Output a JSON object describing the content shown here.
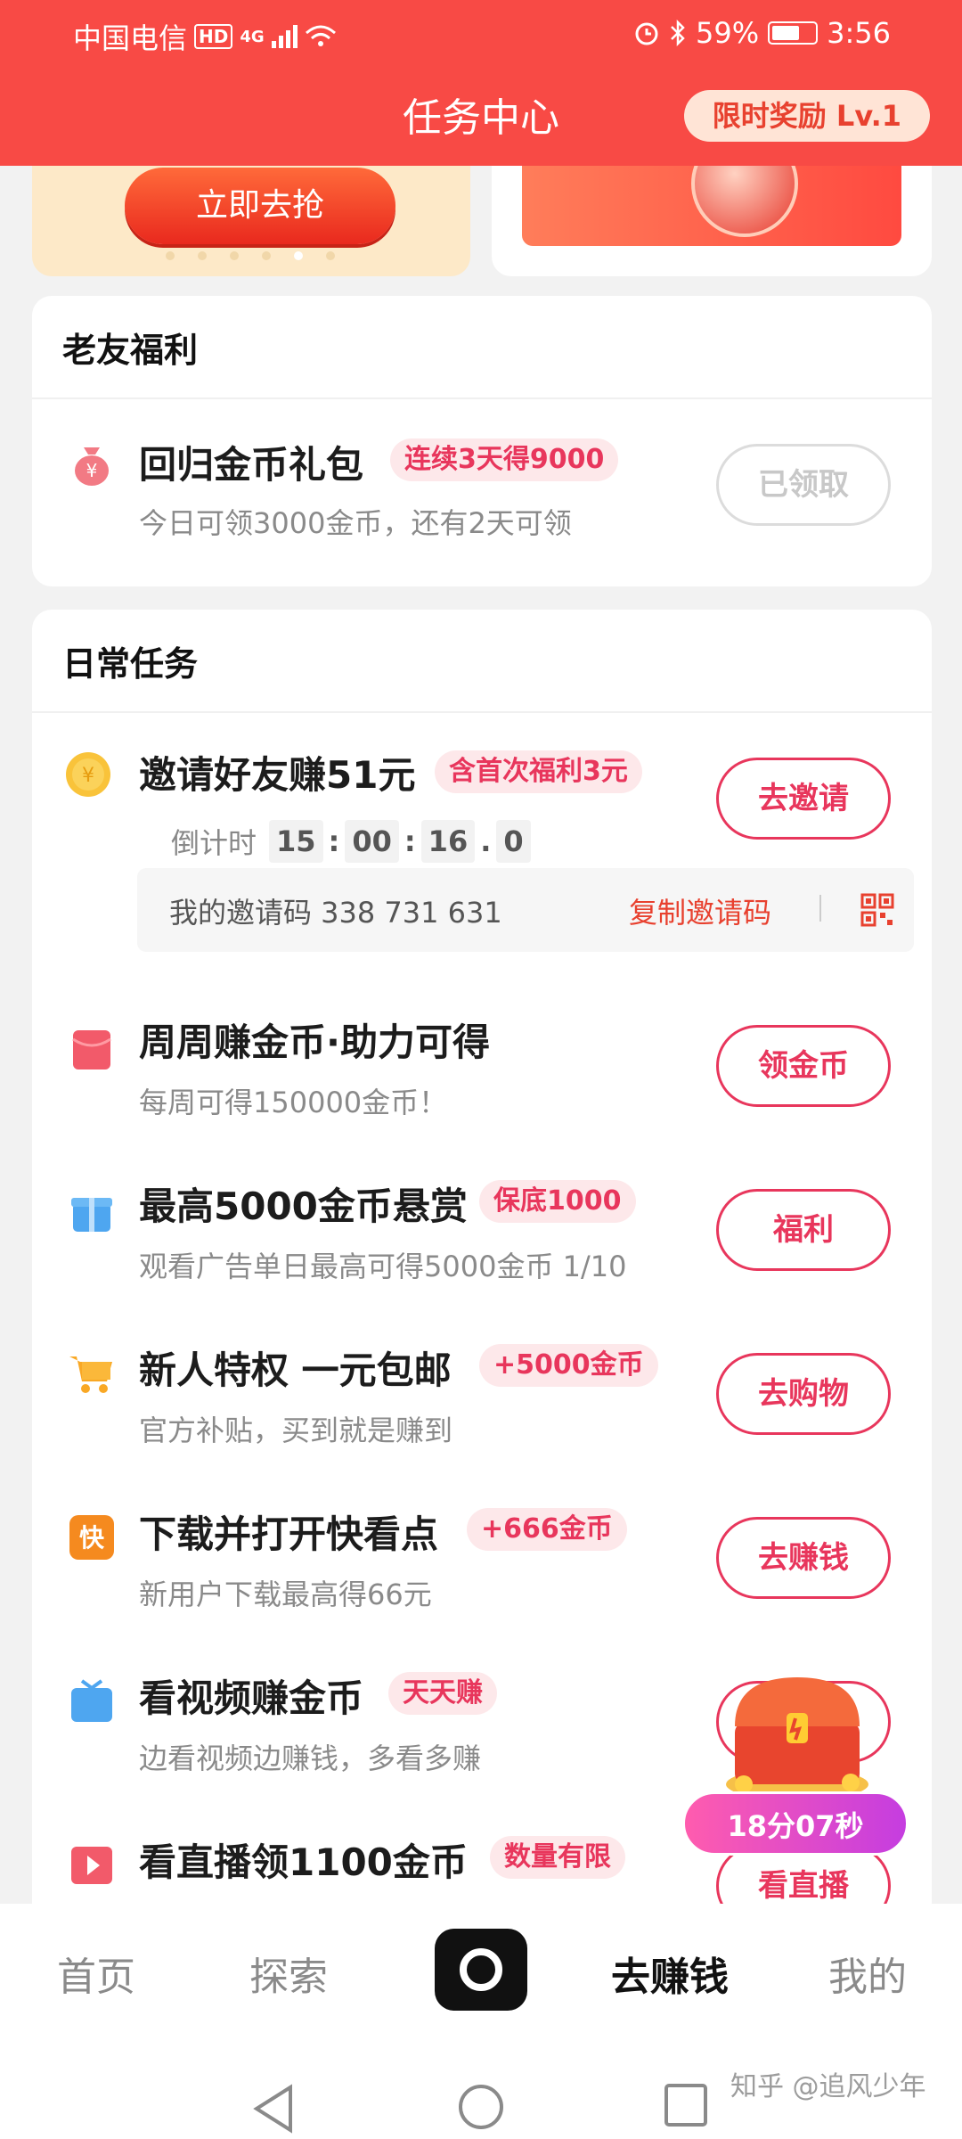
{
  "status_bar": {
    "carrier": "中国电信",
    "hd": "HD",
    "network": "4G",
    "battery": "59%",
    "time": "3:56"
  },
  "header": {
    "title": "任务中心",
    "reward_badge": "限时奖励 Lv.1"
  },
  "banner": {
    "grab_button": "立即去抢"
  },
  "old_friends": {
    "title": "老友福利",
    "task": {
      "title": "回归金币礼包",
      "tag": "连续3天得9000",
      "desc": "今日可领3000金币，还有2天可领",
      "button": "已领取"
    }
  },
  "daily": {
    "title": "日常任务",
    "invite": {
      "title": "邀请好友赚51元",
      "tag": "含首次福利3元",
      "countdown_label": "倒计时",
      "countdown": [
        "15",
        "00",
        "16",
        "0"
      ],
      "button": "去邀请",
      "code_label": "我的邀请码 338 731 631",
      "copy_label": "复制邀请码"
    },
    "tasks": [
      {
        "title": "周周赚金币·助力可得",
        "tag": "",
        "desc": "每周可得150000金币！",
        "button": "领金币"
      },
      {
        "title": "最高5000金币悬赏",
        "tag": "保底1000",
        "desc": "观看广告单日最高可得5000金币 1/10",
        "button": "福利"
      },
      {
        "title": "新人特权 一元包邮",
        "tag": "+5000金币",
        "desc": "官方补贴，买到就是赚到",
        "button": "去购物"
      },
      {
        "title": "下载并打开快看点",
        "tag": "+666金币",
        "desc": "新用户下载最高得66元",
        "button": "去赚钱"
      },
      {
        "title": "看视频赚金币",
        "tag": "天天赚",
        "desc": "边看视频边赚钱，多看多赚",
        "button": ""
      },
      {
        "title": "看直播领1100金币",
        "tag": "数量有限",
        "desc": "",
        "button": "看直播"
      }
    ]
  },
  "floating": {
    "timer": "18分07秒"
  },
  "bottom_nav": {
    "items": [
      "首页",
      "探索",
      "去赚钱",
      "我的"
    ]
  },
  "watermark": "知乎 @追风少年",
  "colors": {
    "header": "#f84a45",
    "accent": "#e8365c",
    "tag_bg": "#fde8ea"
  }
}
